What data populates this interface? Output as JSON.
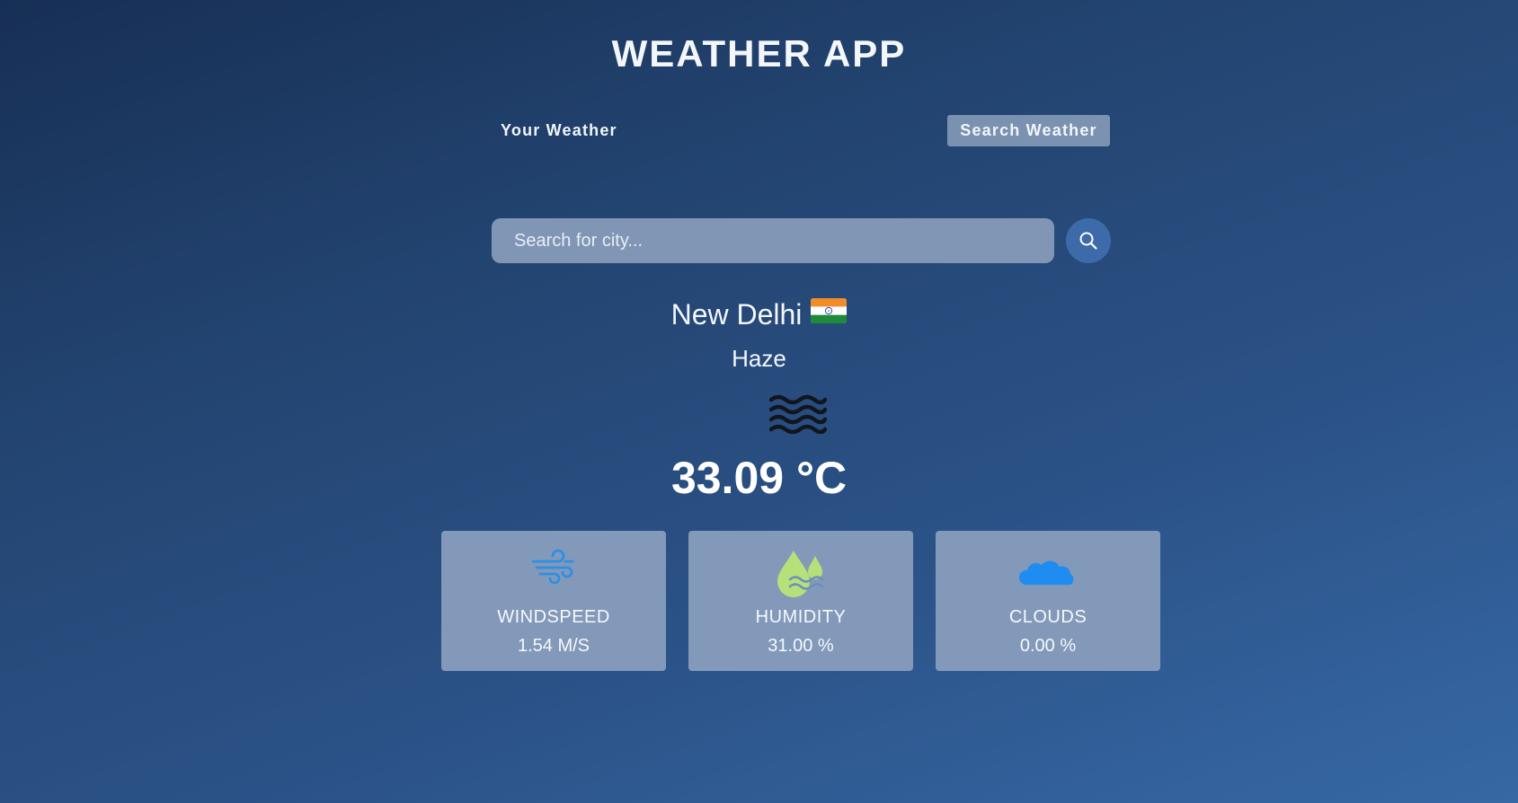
{
  "header": {
    "title": "WEATHER APP"
  },
  "tabs": {
    "your_weather": "Your Weather",
    "search_weather": "Search Weather"
  },
  "search": {
    "placeholder": "Search for city..."
  },
  "current": {
    "city": "New Delhi",
    "flag_icon": "india-flag-icon",
    "condition": "Haze",
    "condition_icon": "haze-icon",
    "temperature": "33.09 °C"
  },
  "stats": [
    {
      "label": "WINDSPEED",
      "value": "1.54 M/S",
      "icon": "wind-icon"
    },
    {
      "label": "HUMIDITY",
      "value": "31.00 %",
      "icon": "humidity-icon"
    },
    {
      "label": "CLOUDS",
      "value": "0.00 %",
      "icon": "cloud-icon"
    }
  ],
  "colors": {
    "background_top": "#172f55",
    "background_bottom": "#3668a5",
    "card_background": "#8399b9",
    "search_button": "#3d6aa8"
  }
}
